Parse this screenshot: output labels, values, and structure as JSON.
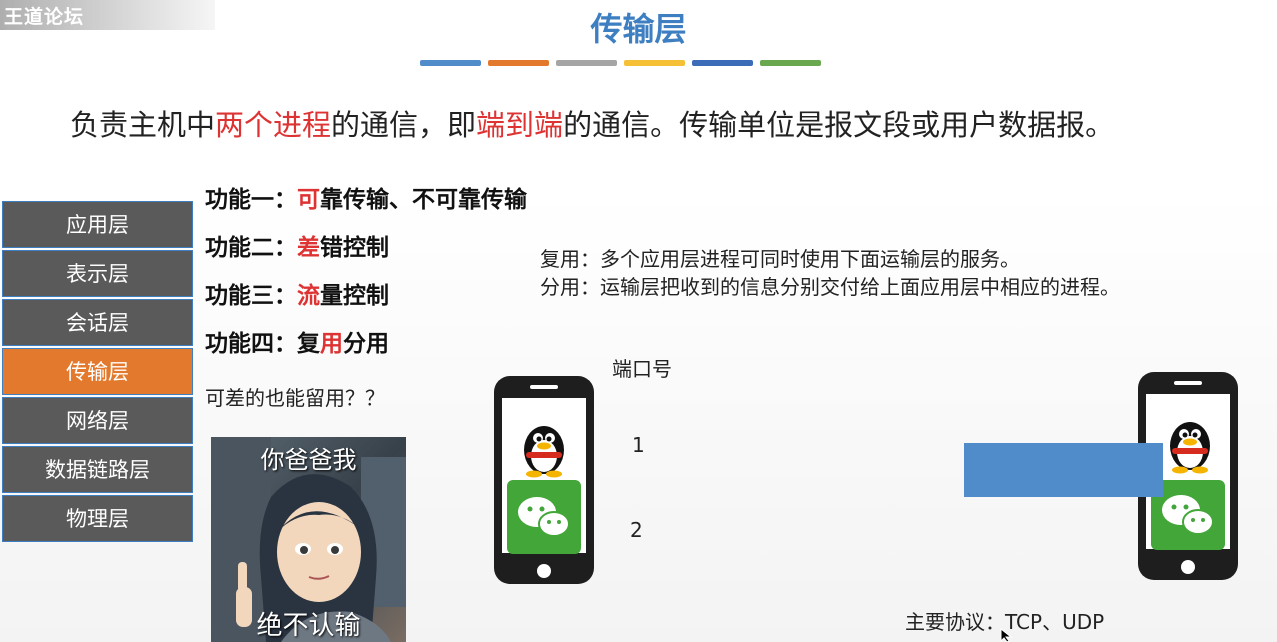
{
  "watermark": "王道论坛",
  "title": "传输层",
  "title_bar_colors": [
    "#4f8cc9",
    "#e3792c",
    "#a5a5a5",
    "#f5c036",
    "#3c6cb8",
    "#6aa84f"
  ],
  "description": {
    "p1": "负责主机中",
    "h1": "两个进程",
    "p2": "的通信，即",
    "h2": "端到端",
    "p3": "的通信。传输单位是报文段或用户数据报。"
  },
  "layers": [
    {
      "label": "应用层"
    },
    {
      "label": "表示层"
    },
    {
      "label": "会话层"
    },
    {
      "label": "传输层",
      "active": true
    },
    {
      "label": "网络层"
    },
    {
      "label": "数据链路层"
    },
    {
      "label": "物理层"
    }
  ],
  "functions": [
    {
      "prefix": "功能一：",
      "hl": "可",
      "rest": "靠传输、不可靠传输"
    },
    {
      "prefix": "功能二：",
      "hl": "差",
      "rest": "错控制"
    },
    {
      "prefix": "功能三：",
      "hl": "流",
      "rest": "量控制"
    },
    {
      "prefix": "功能四：",
      "pre": "复",
      "hl": "用",
      "rest": "分用"
    }
  ],
  "question": "可差的也能留用？？",
  "meme": {
    "top_text": "你爸爸我",
    "bottom_text": "绝不认输"
  },
  "multiplex": "复用：多个应用层进程可同时使用下面运输层的服务。",
  "demultiplex": "分用：运输层把收到的信息分别交付给上面应用层中相应的进程。",
  "port_label": "端口号",
  "port_numbers": [
    "1",
    "2"
  ],
  "protocols": "主要协议：TCP、UDP"
}
